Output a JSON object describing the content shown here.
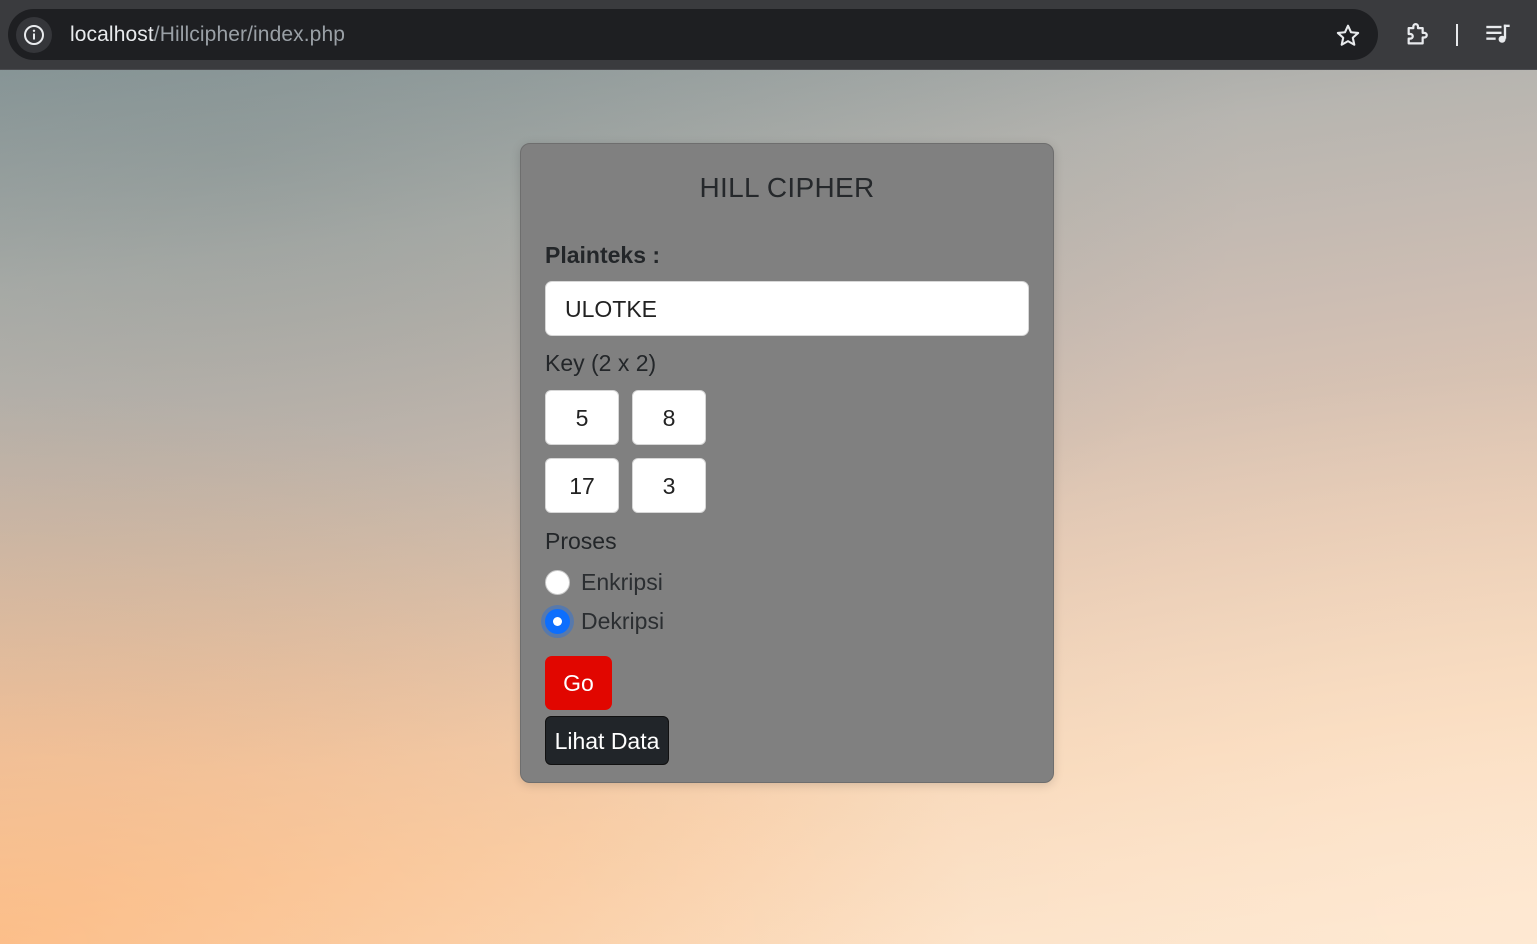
{
  "browser": {
    "url_host": "localhost",
    "url_path": "/Hillcipher/index.php",
    "icons": [
      "info-icon",
      "star-icon",
      "extensions-icon",
      "media-queue-icon"
    ]
  },
  "form": {
    "title": "HILL CIPHER",
    "plaintext_label": "Plainteks :",
    "plaintext_value": "ULOTKE",
    "key_label": "Key (2 x 2)",
    "key": [
      [
        "5",
        "8"
      ],
      [
        "17",
        "3"
      ]
    ],
    "process_label": "Proses",
    "options": [
      {
        "label": "Enkripsi",
        "checked": false
      },
      {
        "label": "Dekripsi",
        "checked": true
      }
    ],
    "go_label": "Go",
    "view_data_label": "Lihat Data"
  },
  "colors": {
    "card": "#808080",
    "go_button": "#e10600",
    "view_data_button": "#212529",
    "radio_checked": "#0d6efd"
  }
}
